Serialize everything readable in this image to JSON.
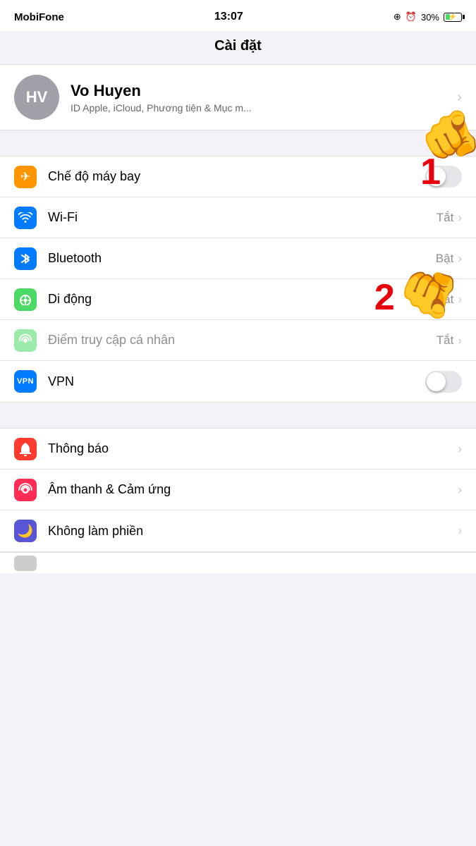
{
  "statusBar": {
    "carrier": "MobiFone",
    "time": "13:07",
    "batteryPercent": "30%",
    "icons": {
      "location": "⊕",
      "alarm": "⏰"
    }
  },
  "navBar": {
    "title": "Cài đặt"
  },
  "profile": {
    "initials": "HV",
    "name": "Vo Huyen",
    "subtitle": "ID Apple, iCloud, Phương tiện & Mục m..."
  },
  "groups": [
    {
      "id": "network",
      "items": [
        {
          "id": "airplane",
          "icon": "✈",
          "iconBg": "orange",
          "label": "Chế độ máy bay",
          "rightType": "toggle",
          "toggleOn": false,
          "value": ""
        },
        {
          "id": "wifi",
          "icon": "wifi",
          "iconBg": "blue",
          "label": "Wi-Fi",
          "rightType": "value-chevron",
          "value": "Tắt"
        },
        {
          "id": "bluetooth",
          "icon": "bluetooth",
          "iconBg": "blue",
          "label": "Bluetooth",
          "rightType": "value-chevron",
          "value": "Bật"
        },
        {
          "id": "cellular",
          "icon": "cellular",
          "iconBg": "green",
          "label": "Di động",
          "rightType": "value-chevron",
          "value": "Tắt"
        },
        {
          "id": "hotspot",
          "icon": "hotspot",
          "iconBg": "green-light",
          "label": "Điểm truy cập cá nhân",
          "rightType": "value-chevron",
          "value": "Tắt",
          "disabled": true
        },
        {
          "id": "vpn",
          "icon": "VPN",
          "iconBg": "blue",
          "label": "VPN",
          "rightType": "toggle",
          "toggleOn": false
        }
      ]
    },
    {
      "id": "notifications",
      "items": [
        {
          "id": "notifications",
          "icon": "notif",
          "iconBg": "red",
          "label": "Thông báo",
          "rightType": "chevron"
        },
        {
          "id": "sounds",
          "icon": "sound",
          "iconBg": "pink",
          "label": "Âm thanh & Cảm ứng",
          "rightType": "chevron"
        },
        {
          "id": "donotdisturb",
          "icon": "moon",
          "iconBg": "purple",
          "label": "Không làm phiền",
          "rightType": "chevron"
        }
      ]
    }
  ],
  "annotations": {
    "hand1": "👆",
    "hand2": "👆",
    "number1": "1",
    "number2": "2"
  }
}
